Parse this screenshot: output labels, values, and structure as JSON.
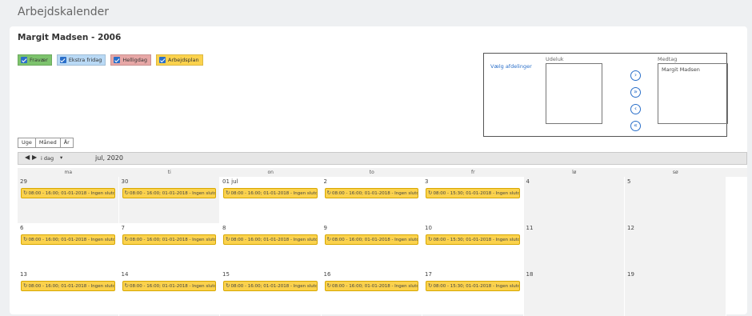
{
  "page": {
    "title": "Arbejdskalender"
  },
  "person": {
    "title": "Margit Madsen - 2006"
  },
  "legend": [
    {
      "label": "Fravær",
      "color": "#7dc36d"
    },
    {
      "label": "Ekstra fridag",
      "color": "#b9d9f5"
    },
    {
      "label": "Helligdag",
      "color": "#e7a7a6"
    },
    {
      "label": "Arbejdsplan",
      "color": "#fbd24d"
    }
  ],
  "departments": {
    "choose_label": "Vælg afdelinger",
    "exclude_label": "Udeluk",
    "include_label": "Medtag",
    "included": [
      "Margit Madsen"
    ],
    "buttons": [
      "›",
      "»",
      "‹",
      "«"
    ]
  },
  "views": [
    "Uge",
    "Måned",
    "År"
  ],
  "nav": {
    "prev": "◀",
    "next": "▶",
    "today": "i dag",
    "today_caret": "▾",
    "month": "jul, 2020"
  },
  "weekdays": [
    "ma",
    "ti",
    "on",
    "to",
    "fr",
    "lø",
    "sø"
  ],
  "event_icon": "↻",
  "weeks": [
    [
      {
        "day": "29",
        "event": "08:00 - 16:00; 01-01-2018 - Ingen slutdato"
      },
      {
        "day": "30",
        "event": "08:00 - 16:00; 01-01-2018 - Ingen slutdato"
      },
      {
        "day": "01 jul",
        "event": "08:00 - 16:00; 01-01-2018 - Ingen slutdato"
      },
      {
        "day": "2",
        "event": "08:00 - 16:00; 01-01-2018 - Ingen slutdato"
      },
      {
        "day": "3",
        "event": "08:00 - 15:30; 01-01-2018 - Ingen slutdato"
      },
      {
        "day": "4",
        "event": ""
      },
      {
        "day": "5",
        "event": ""
      }
    ],
    [
      {
        "day": "6",
        "event": "08:00 - 16:00; 01-01-2018 - Ingen slutdato"
      },
      {
        "day": "7",
        "event": "08:00 - 16:00; 01-01-2018 - Ingen slutdato"
      },
      {
        "day": "8",
        "event": "08:00 - 16:00; 01-01-2018 - Ingen slutdato"
      },
      {
        "day": "9",
        "event": "08:00 - 16:00; 01-01-2018 - Ingen slutdato"
      },
      {
        "day": "10",
        "event": "08:00 - 15:30; 01-01-2018 - Ingen slutdato"
      },
      {
        "day": "11",
        "event": ""
      },
      {
        "day": "12",
        "event": ""
      }
    ],
    [
      {
        "day": "13",
        "event": "08:00 - 16:00; 01-01-2018 - Ingen slutdato"
      },
      {
        "day": "14",
        "event": "08:00 - 16:00; 01-01-2018 - Ingen slutdato"
      },
      {
        "day": "15",
        "event": "08:00 - 16:00; 01-01-2018 - Ingen slutdato"
      },
      {
        "day": "16",
        "event": "08:00 - 16:00; 01-01-2018 - Ingen slutdato"
      },
      {
        "day": "17",
        "event": "08:00 - 15:30; 01-01-2018 - Ingen slutdato"
      },
      {
        "day": "18",
        "event": ""
      },
      {
        "day": "19",
        "event": ""
      }
    ]
  ]
}
